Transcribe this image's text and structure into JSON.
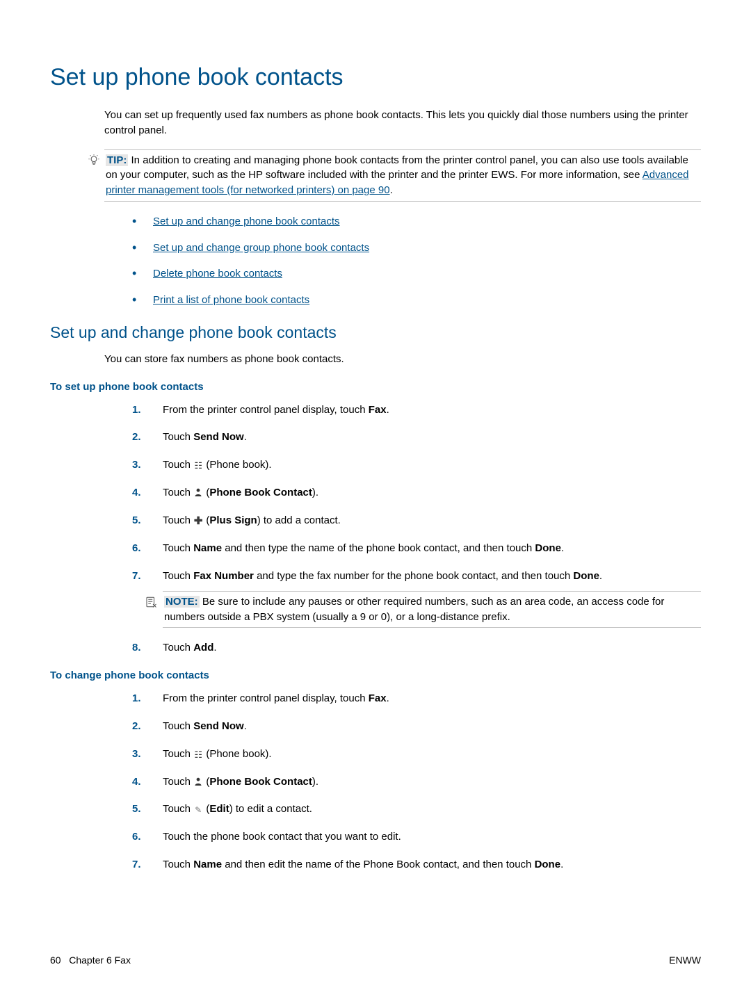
{
  "title": "Set up phone book contacts",
  "intro": "You can set up frequently used fax numbers as phone book contacts. This lets you quickly dial those numbers using the printer control panel.",
  "tip": {
    "label": "TIP:",
    "before": "In addition to creating and managing phone book contacts from the printer control panel, you can also use tools available on your computer, such as the HP software included with the printer and the printer EWS. For more information, see ",
    "link": "Advanced printer management tools (for networked printers) on page 90",
    "after": "."
  },
  "toc": [
    "Set up and change phone book contacts",
    "Set up and change group phone book contacts",
    "Delete phone book contacts",
    "Print a list of phone book contacts"
  ],
  "section_title": "Set up and change phone book contacts",
  "section_para": "You can store fax numbers as phone book contacts.",
  "proc1": {
    "title": "To set up phone book contacts",
    "steps": {
      "s1a": "From the printer control panel display, touch ",
      "s1b": "Fax",
      "s1c": ".",
      "s2a": "Touch ",
      "s2b": "Send Now",
      "s2c": ".",
      "s3a": "Touch ",
      "s3b": " (Phone book).",
      "s4a": "Touch ",
      "s4b": " (",
      "s4c": "Phone Book Contact",
      "s4d": ").",
      "s5a": "Touch ",
      "s5b": " (",
      "s5c": "Plus Sign",
      "s5d": ") to add a contact.",
      "s6a": "Touch ",
      "s6b": "Name",
      "s6c": " and then type the name of the phone book contact, and then touch ",
      "s6d": "Done",
      "s6e": ".",
      "s7a": "Touch ",
      "s7b": "Fax Number",
      "s7c": " and type the fax number for the phone book contact, and then touch ",
      "s7d": "Done",
      "s7e": ".",
      "s8a": "Touch ",
      "s8b": "Add",
      "s8c": "."
    },
    "note": {
      "label": "NOTE:",
      "text": "Be sure to include any pauses or other required numbers, such as an area code, an access code for numbers outside a PBX system (usually a 9 or 0), or a long-distance prefix."
    }
  },
  "proc2": {
    "title": "To change phone book contacts",
    "steps": {
      "s1a": "From the printer control panel display, touch ",
      "s1b": "Fax",
      "s1c": ".",
      "s2a": "Touch ",
      "s2b": "Send Now",
      "s2c": ".",
      "s3a": "Touch ",
      "s3b": " (Phone book).",
      "s4a": "Touch ",
      "s4b": " (",
      "s4c": "Phone Book Contact",
      "s4d": ").",
      "s5a": "Touch ",
      "s5b": " (",
      "s5c": "Edit",
      "s5d": ") to edit a contact.",
      "s6": "Touch the phone book contact that you want to edit.",
      "s7a": "Touch ",
      "s7b": "Name",
      "s7c": " and then edit the name of the Phone Book contact, and then touch ",
      "s7d": "Done",
      "s7e": "."
    }
  },
  "footer": {
    "left_page": "60",
    "left_chapter": "Chapter 6   Fax",
    "right": "ENWW"
  },
  "nums": {
    "n1": "1.",
    "n2": "2.",
    "n3": "3.",
    "n4": "4.",
    "n5": "5.",
    "n6": "6.",
    "n7": "7.",
    "n8": "8."
  }
}
